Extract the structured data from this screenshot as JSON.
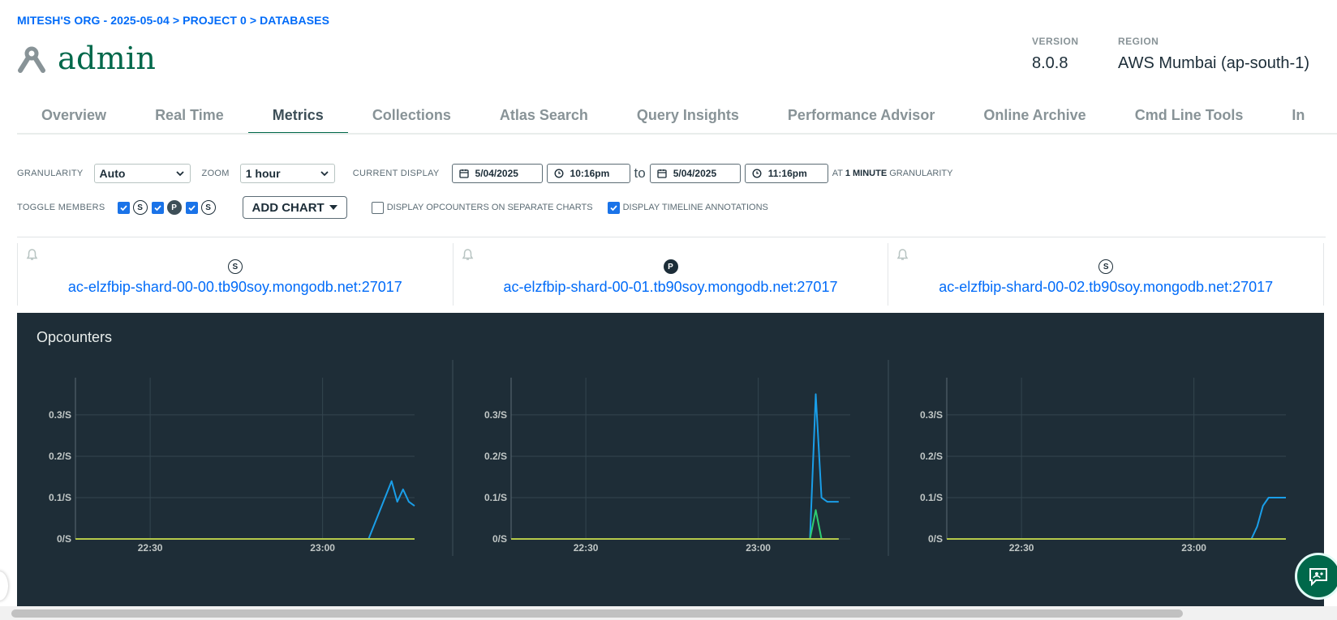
{
  "breadcrumb": "MITESH'S ORG - 2025-05-04 > PROJECT 0 > DATABASES",
  "title": "admin",
  "meta": {
    "version_label": "VERSION",
    "version_value": "8.0.8",
    "region_label": "REGION",
    "region_value": "AWS Mumbai (ap-south-1)"
  },
  "tabs": [
    "Overview",
    "Real Time",
    "Metrics",
    "Collections",
    "Atlas Search",
    "Query Insights",
    "Performance Advisor",
    "Online Archive",
    "Cmd Line Tools",
    "In"
  ],
  "active_tab": "Metrics",
  "controls": {
    "granularity_label": "GRANULARITY",
    "granularity_value": "Auto",
    "zoom_label": "ZOOM",
    "zoom_value": "1 hour",
    "current_display_label": "CURRENT DISPLAY",
    "start_date": "5/04/2025",
    "start_time": "10:16pm",
    "to_label": "to",
    "end_date": "5/04/2025",
    "end_time": "11:16pm",
    "at_label": "AT",
    "granularity_amount": "1 MINUTE",
    "granularity_suffix": "GRANULARITY",
    "toggle_members_label": "TOGGLE MEMBERS",
    "member_badges": [
      "S",
      "P",
      "S"
    ],
    "add_chart_label": "ADD CHART",
    "separate_charts_label": "DISPLAY OPCOUNTERS ON SEPARATE CHARTS",
    "separate_charts_checked": false,
    "annotations_label": "DISPLAY TIMELINE ANNOTATIONS",
    "annotations_checked": true
  },
  "hosts": [
    {
      "role": "S",
      "name": "ac-elzfbip-shard-00-00.tb90soy.mongodb.net:27017"
    },
    {
      "role": "P",
      "name": "ac-elzfbip-shard-00-01.tb90soy.mongodb.net:27017"
    },
    {
      "role": "S",
      "name": "ac-elzfbip-shard-00-02.tb90soy.mongodb.net:27017"
    }
  ],
  "chart_title": "Opcounters",
  "colors": {
    "accent_green": "#00684a",
    "link_blue": "#016bf8",
    "panel_bg": "#1e2d37",
    "series_blue": "#1a9ee8",
    "series_green": "#2ecc71",
    "series_yellow": "#b5c94a"
  },
  "chart_data": [
    {
      "type": "line",
      "host": "ac-elzfbip-shard-00-00.tb90soy.mongodb.net:27017",
      "xlim": [
        "22:17",
        "23:16"
      ],
      "x_ticks": [
        "22:30",
        "23:00"
      ],
      "y_ticks": [
        "0/S",
        "0.1/S",
        "0.2/S",
        "0.3/S"
      ],
      "ylim": [
        0,
        0.39
      ],
      "series": [
        {
          "color": "#1a9ee8",
          "x": [
            "22:17",
            "23:08",
            "23:12",
            "23:13",
            "23:14",
            "23:15",
            "23:16"
          ],
          "y": [
            0,
            0,
            0.14,
            0.09,
            0.12,
            0.09,
            0.08
          ]
        },
        {
          "color": "#b5c94a",
          "x": [
            "22:17",
            "23:16"
          ],
          "y": [
            0,
            0
          ]
        }
      ]
    },
    {
      "type": "line",
      "host": "ac-elzfbip-shard-00-01.tb90soy.mongodb.net:27017",
      "xlim": [
        "22:17",
        "23:16"
      ],
      "x_ticks": [
        "22:30",
        "23:00"
      ],
      "y_ticks": [
        "0/S",
        "0.1/S",
        "0.2/S",
        "0.3/S"
      ],
      "ylim": [
        0,
        0.39
      ],
      "series": [
        {
          "color": "#1a9ee8",
          "x": [
            "22:17",
            "23:09",
            "23:10",
            "23:11",
            "23:12",
            "23:13",
            "23:14"
          ],
          "y": [
            0,
            0,
            0.35,
            0.1,
            0.09,
            0.09,
            0.09
          ]
        },
        {
          "color": "#2ecc71",
          "x": [
            "22:17",
            "23:09",
            "23:10",
            "23:11",
            "23:14"
          ],
          "y": [
            0,
            0,
            0.07,
            0,
            0
          ]
        },
        {
          "color": "#b5c94a",
          "x": [
            "22:17",
            "23:14"
          ],
          "y": [
            0,
            0
          ]
        }
      ]
    },
    {
      "type": "line",
      "host": "ac-elzfbip-shard-00-02.tb90soy.mongodb.net:27017",
      "xlim": [
        "22:17",
        "23:16"
      ],
      "x_ticks": [
        "22:30",
        "23:00"
      ],
      "y_ticks": [
        "0/S",
        "0.1/S",
        "0.2/S",
        "0.3/S"
      ],
      "ylim": [
        0,
        0.39
      ],
      "series": [
        {
          "color": "#1a9ee8",
          "x": [
            "22:17",
            "23:10",
            "23:11",
            "23:12",
            "23:13",
            "23:14",
            "23:16"
          ],
          "y": [
            0,
            0,
            0.03,
            0.08,
            0.1,
            0.1,
            0.1
          ]
        },
        {
          "color": "#b5c94a",
          "x": [
            "22:17",
            "23:16"
          ],
          "y": [
            0,
            0
          ]
        }
      ]
    }
  ]
}
